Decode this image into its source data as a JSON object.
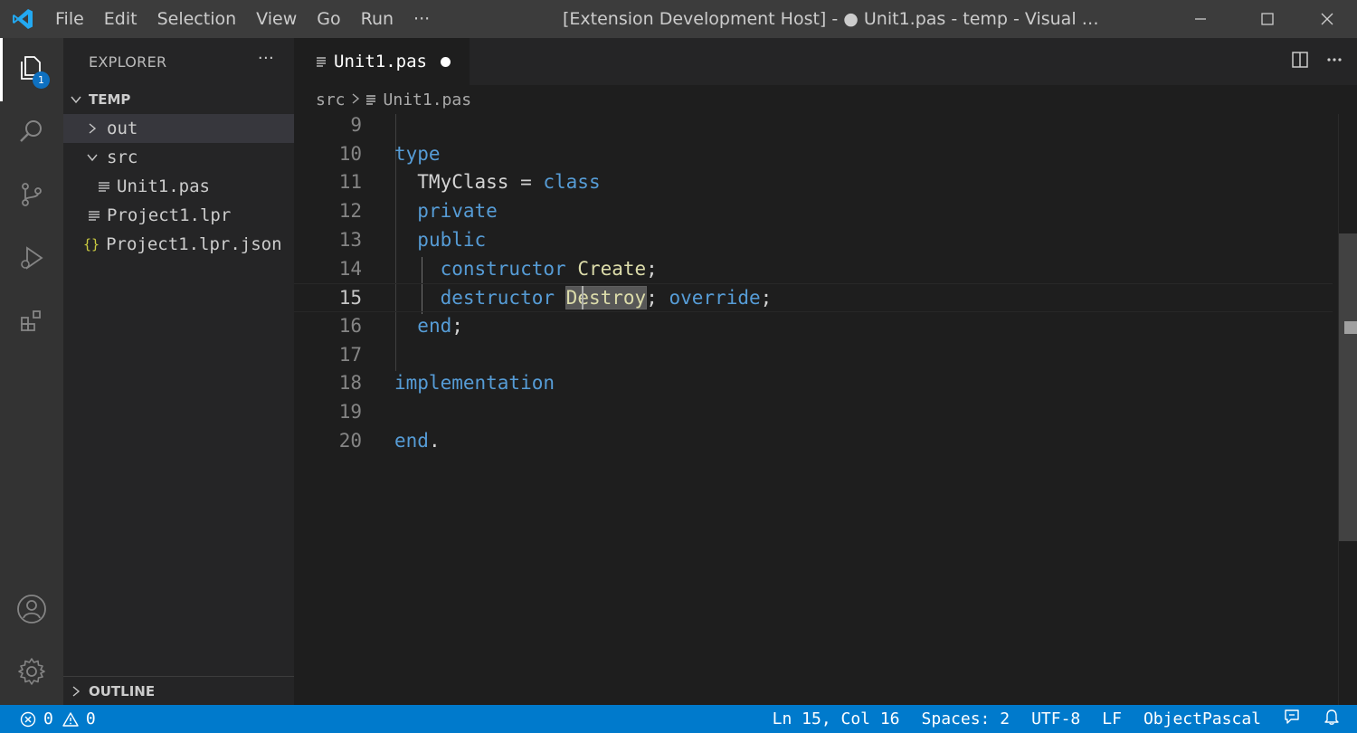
{
  "titlebar": {
    "menu": [
      "File",
      "Edit",
      "Selection",
      "View",
      "Go",
      "Run",
      "···"
    ],
    "title": "[Extension Development Host] - ● Unit1.pas - temp - Visual …"
  },
  "activitybar": {
    "icons": [
      "explorer-icon",
      "search-icon",
      "source-control-icon",
      "run-debug-icon",
      "extensions-icon",
      "accounts-icon",
      "settings-gear-icon"
    ],
    "explorer_badge": "1"
  },
  "sidebar": {
    "title": "EXPLORER",
    "more": "···",
    "root": "TEMP",
    "tree": [
      {
        "label": "out",
        "kind": "folder-collapsed"
      },
      {
        "label": "src",
        "kind": "folder-expanded"
      },
      {
        "label": "Unit1.pas",
        "kind": "file"
      },
      {
        "label": "Project1.lpr",
        "kind": "file"
      },
      {
        "label": "Project1.lpr.json",
        "kind": "json",
        "icon_text": "{}"
      }
    ],
    "outline": "OUTLINE"
  },
  "editor": {
    "tab_label": "Unit1.pas",
    "breadcrumb": [
      "src",
      "Unit1.pas"
    ],
    "lines": [
      {
        "n": "9",
        "tokens": []
      },
      {
        "n": "10",
        "tokens": [
          {
            "t": "type",
            "c": "kw"
          }
        ]
      },
      {
        "n": "11",
        "tokens": [
          {
            "t": "  TMyClass = ",
            "c": "pl"
          },
          {
            "t": "class",
            "c": "kw"
          }
        ]
      },
      {
        "n": "12",
        "tokens": [
          {
            "t": "  ",
            "c": "pl"
          },
          {
            "t": "private",
            "c": "kw"
          }
        ]
      },
      {
        "n": "13",
        "tokens": [
          {
            "t": "  ",
            "c": "pl"
          },
          {
            "t": "public",
            "c": "kw"
          }
        ]
      },
      {
        "n": "14",
        "tokens": [
          {
            "t": "    ",
            "c": "pl"
          },
          {
            "t": "constructor",
            "c": "kw"
          },
          {
            "t": " ",
            "c": "pl"
          },
          {
            "t": "Create",
            "c": "fn"
          },
          {
            "t": ";",
            "c": "pl"
          }
        ]
      },
      {
        "n": "15",
        "tokens": [
          {
            "t": "    ",
            "c": "pl"
          },
          {
            "t": "destructor",
            "c": "kw"
          },
          {
            "t": " ",
            "c": "pl"
          },
          {
            "t": "Destroy",
            "c": "fn hl"
          },
          {
            "t": "; ",
            "c": "pl"
          },
          {
            "t": "override",
            "c": "kw"
          },
          {
            "t": ";",
            "c": "pl"
          }
        ]
      },
      {
        "n": "16",
        "tokens": [
          {
            "t": "  ",
            "c": "pl"
          },
          {
            "t": "end",
            "c": "kw"
          },
          {
            "t": ";",
            "c": "pl"
          }
        ]
      },
      {
        "n": "17",
        "tokens": []
      },
      {
        "n": "18",
        "tokens": [
          {
            "t": "implementation",
            "c": "kw"
          }
        ]
      },
      {
        "n": "19",
        "tokens": []
      },
      {
        "n": "20",
        "tokens": [
          {
            "t": "end",
            "c": "kw"
          },
          {
            "t": ".",
            "c": "pl"
          }
        ]
      }
    ],
    "current_line": "15"
  },
  "statusbar": {
    "errors": "0",
    "warnings": "0",
    "position": "Ln 15, Col 16",
    "spaces": "Spaces: 2",
    "encoding": "UTF-8",
    "eol": "LF",
    "language": "ObjectPascal"
  },
  "colors": {
    "keyword": "#569cd6",
    "function": "#dcdcaa",
    "plain": "#d4d4d4",
    "statusbar": "#007acc",
    "activitybar": "#333333",
    "sidebar": "#252526",
    "editor": "#1e1e1e"
  }
}
